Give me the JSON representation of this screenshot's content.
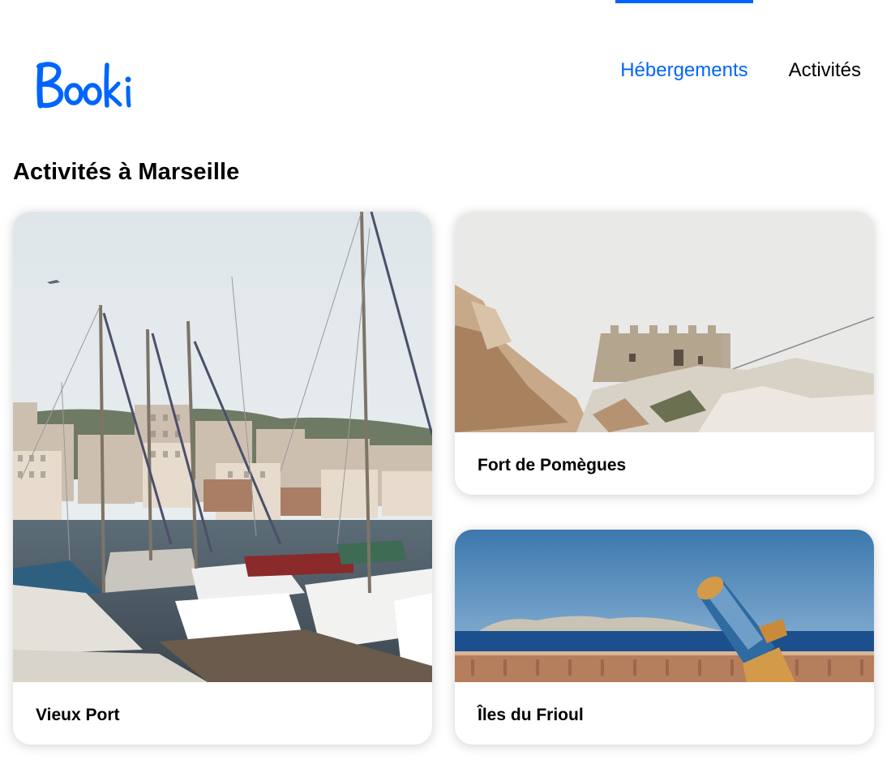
{
  "header": {
    "logo_text": "Booki",
    "nav": [
      {
        "label": "Hébergements",
        "active": true
      },
      {
        "label": "Activités",
        "active": false
      }
    ]
  },
  "main": {
    "title": "Activités à Marseille",
    "cards": [
      {
        "name": "Vieux Port",
        "image": "harbor-with-sailboats-photo"
      },
      {
        "name": "Fort de Pomègues",
        "image": "fortress-on-rocks-photo"
      },
      {
        "name": "Îles du Frioul",
        "image": "islands-sea-telescope-photo"
      }
    ]
  },
  "colors": {
    "accent": "#0065FC",
    "text": "#000000",
    "background": "#FFFFFF"
  }
}
